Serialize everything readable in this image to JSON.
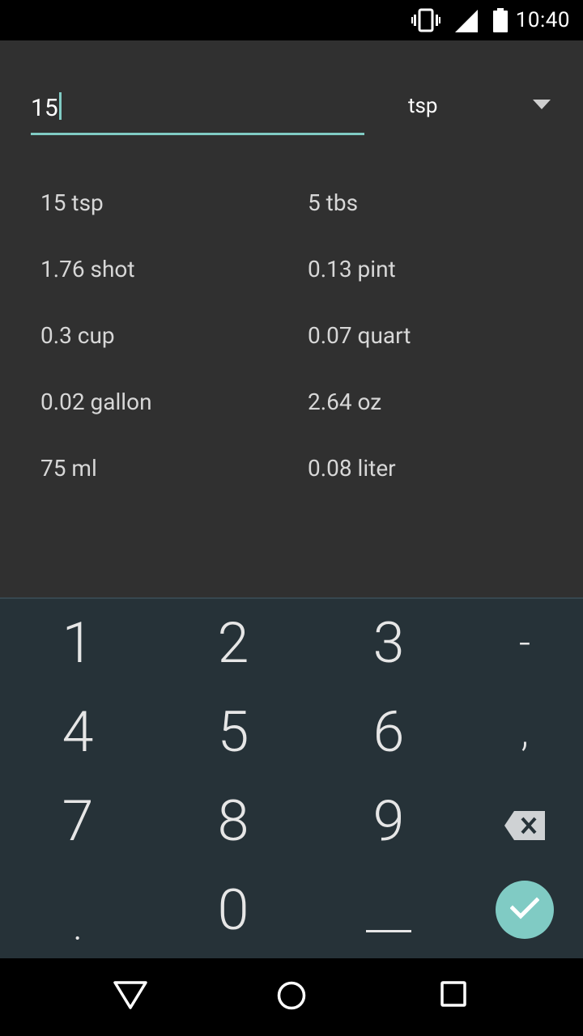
{
  "status_bar": {
    "time": "10:40",
    "icons": [
      "vibrate-icon",
      "signal-icon",
      "battery-icon"
    ]
  },
  "converter": {
    "input_value": "15",
    "unit": "tsp"
  },
  "results": [
    "15 tsp",
    "5 tbs",
    "1.76 shot",
    "0.13 pint",
    "0.3 cup",
    "0.07 quart",
    "0.02 gallon",
    "2.64 oz",
    "75 ml",
    "0.08 liter"
  ],
  "keypad": {
    "keys": [
      "1",
      "2",
      "3",
      "-",
      "4",
      "5",
      "6",
      ",",
      "7",
      "8",
      "9",
      ".",
      "0",
      "_"
    ],
    "backspace_icon": "backspace-icon",
    "done_icon": "check-icon"
  },
  "nav_bar": {
    "icons": [
      "back-icon",
      "home-icon",
      "recents-icon"
    ]
  },
  "colors": {
    "accent": "#80CBC4",
    "content_bg": "#303030",
    "keypad_bg": "#263238",
    "text": "#d7d7d7"
  }
}
